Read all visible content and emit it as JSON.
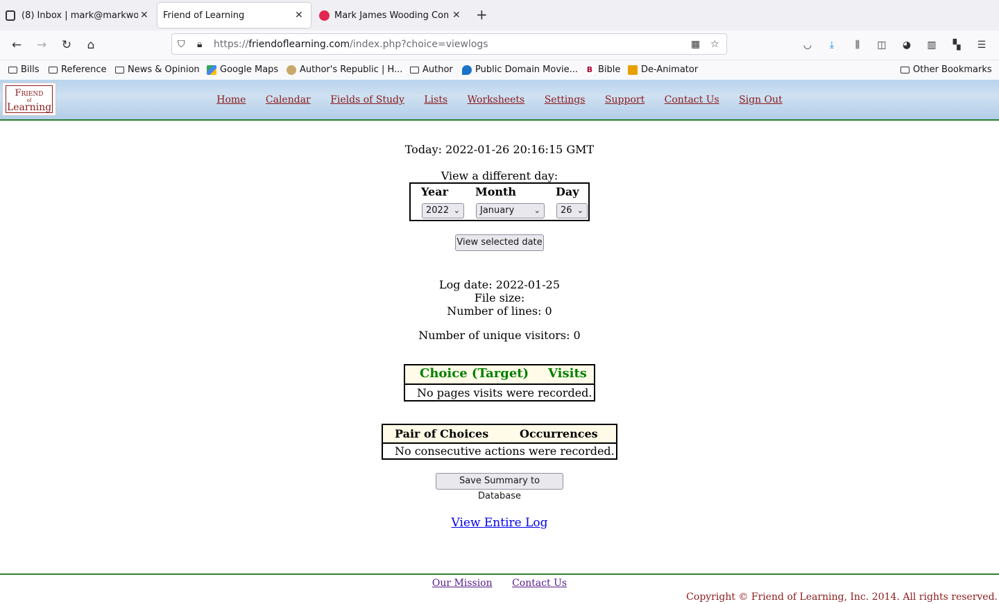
{
  "browser": {
    "tabs": [
      {
        "title": "(8) Inbox | mark@markwo",
        "active": false
      },
      {
        "title": "Friend of Learning",
        "active": true
      },
      {
        "title": "Mark James Wooding Com",
        "active": false
      }
    ],
    "url": {
      "scheme": "https://",
      "host": "friendoflearning.com",
      "path": "/index.php?choice=viewlogs"
    },
    "bookmarks": [
      {
        "label": "Bills",
        "icon": "folder-icon"
      },
      {
        "label": "Reference",
        "icon": "folder-icon"
      },
      {
        "label": "News & Opinion",
        "icon": "folder-icon"
      },
      {
        "label": "Google Maps",
        "icon": "maps-icon"
      },
      {
        "label": "Author's Republic | H...",
        "icon": "site-icon"
      },
      {
        "label": "Author",
        "icon": "folder-icon"
      },
      {
        "label": "Public Domain Movie...",
        "icon": "site-icon"
      },
      {
        "label": "Bible",
        "icon": "site-icon"
      },
      {
        "label": "De-Animator",
        "icon": "site-icon"
      }
    ],
    "other_bookmarks": "Other Bookmarks"
  },
  "site": {
    "logo": {
      "line1": "Friend",
      "line2": "of",
      "line3": "Learning"
    },
    "nav": [
      "Home",
      "Calendar",
      "Fields of Study",
      "Lists",
      "Worksheets",
      "Settings",
      "Support",
      "Contact Us",
      "Sign Out"
    ]
  },
  "page": {
    "today": "Today: 2022-01-26 20:16:15 GMT",
    "view_different_day": "View a different day:",
    "date_headers": {
      "year": "Year",
      "month": "Month",
      "day": "Day"
    },
    "selected": {
      "year": "2022",
      "month": "January",
      "day": "26"
    },
    "view_selected_button": "View selected date",
    "log_date": "Log date: 2022-01-25",
    "file_size": "File size:",
    "num_lines": "Number of lines: 0",
    "unique_visitors": "Number of unique visitors: 0",
    "visits_table": {
      "col1": "Choice (Target)",
      "col2": "Visits",
      "empty": "No pages visits were recorded.",
      "header_color": "#008000"
    },
    "pairs_table": {
      "col1": "Pair of Choices",
      "col2": "Occurrences",
      "empty": "No consecutive actions were recorded."
    },
    "save_button": "Save Summary to Database",
    "view_entire_log": "View Entire Log"
  },
  "footer": {
    "links": [
      "Our Mission",
      "Contact Us"
    ],
    "copyright": "Copyright © Friend of Learning, Inc. 2014. All rights reserved."
  }
}
